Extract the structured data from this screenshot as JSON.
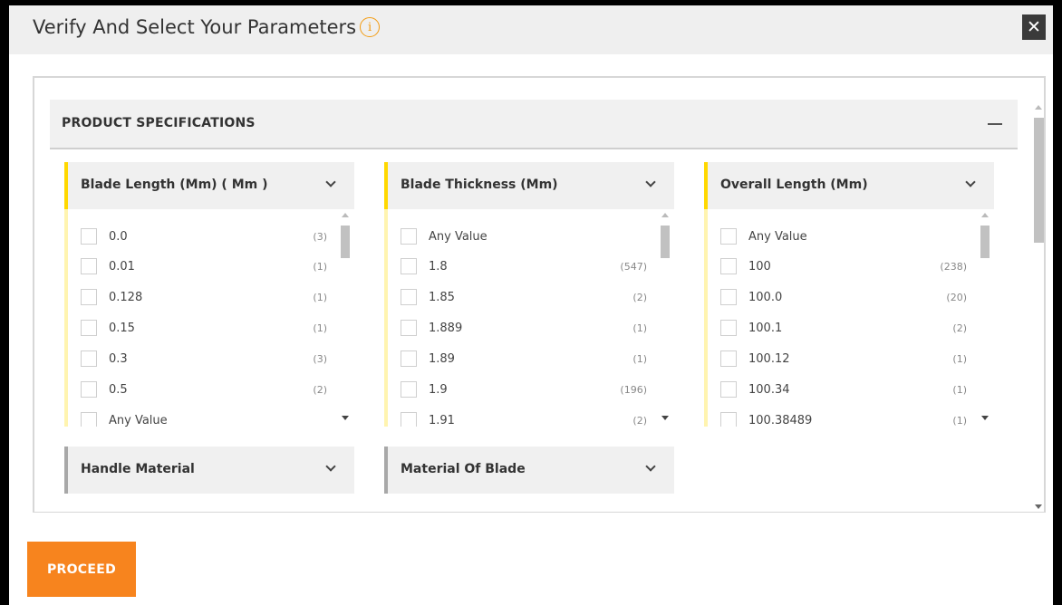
{
  "modal": {
    "title": "Verify And Select Your Parameters",
    "info_icon": "i",
    "close_icon": "✕",
    "proceed_label": "PROCEED",
    "accent_color": "#f7841e",
    "filter_accent_color": "#ffd800"
  },
  "section": {
    "title": "PRODUCT SPECIFICATIONS",
    "collapse_icon": "minus-icon"
  },
  "filters": [
    {
      "title": "Blade Length (Mm) ( Mm )",
      "expanded": true,
      "options": [
        {
          "label": "0.0",
          "count": "(3)"
        },
        {
          "label": "0.01",
          "count": "(1)"
        },
        {
          "label": "0.128",
          "count": "(1)"
        },
        {
          "label": "0.15",
          "count": "(1)"
        },
        {
          "label": "0.3",
          "count": "(3)"
        },
        {
          "label": "0.5",
          "count": "(2)"
        },
        {
          "label": "Any Value",
          "count": ""
        }
      ]
    },
    {
      "title": "Blade Thickness (Mm)",
      "expanded": true,
      "options": [
        {
          "label": "Any Value",
          "count": ""
        },
        {
          "label": "1.8",
          "count": "(547)"
        },
        {
          "label": "1.85",
          "count": "(2)"
        },
        {
          "label": "1.889",
          "count": "(1)"
        },
        {
          "label": "1.89",
          "count": "(1)"
        },
        {
          "label": "1.9",
          "count": "(196)"
        },
        {
          "label": "1.91",
          "count": "(2)"
        }
      ]
    },
    {
      "title": "Overall Length (Mm)",
      "expanded": true,
      "options": [
        {
          "label": "Any Value",
          "count": ""
        },
        {
          "label": "100",
          "count": "(238)"
        },
        {
          "label": "100.0",
          "count": "(20)"
        },
        {
          "label": "100.1",
          "count": "(2)"
        },
        {
          "label": "100.12",
          "count": "(1)"
        },
        {
          "label": "100.34",
          "count": "(1)"
        },
        {
          "label": "100.38489",
          "count": "(1)"
        }
      ]
    },
    {
      "title": "Handle Material",
      "expanded": false,
      "options": []
    },
    {
      "title": "Material Of Blade",
      "expanded": false,
      "options": []
    }
  ]
}
